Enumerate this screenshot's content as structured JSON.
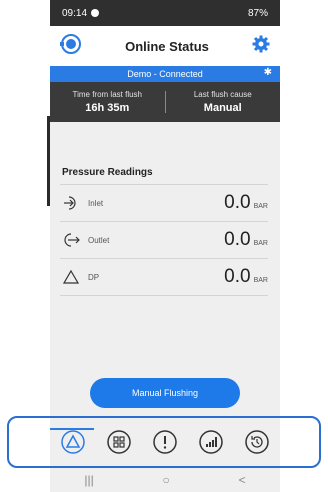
{
  "statusbar": {
    "time": "09:14",
    "right": "87%"
  },
  "header": {
    "title": "Online Status"
  },
  "connection": {
    "text": "Demo - Connected"
  },
  "flush": {
    "time_label": "Time from last flush",
    "time_value": "16h 35m",
    "cause_label": "Last flush cause",
    "cause_value": "Manual"
  },
  "pressure": {
    "title": "Pressure Readings",
    "rows": [
      {
        "label": "Inlet",
        "value": "0.0",
        "unit": "BAR"
      },
      {
        "label": "Outlet",
        "value": "0.0",
        "unit": "BAR"
      },
      {
        "label": "DP",
        "value": "0.0",
        "unit": "BAR"
      }
    ]
  },
  "actions": {
    "manual_flushing": "Manual Flushing"
  },
  "system_nav": {
    "recents": "|||",
    "home": "○",
    "back": "<"
  },
  "colors": {
    "accent": "#2a7be4",
    "dark_bar": "#3a3a3a",
    "button": "#1e7ae8"
  }
}
